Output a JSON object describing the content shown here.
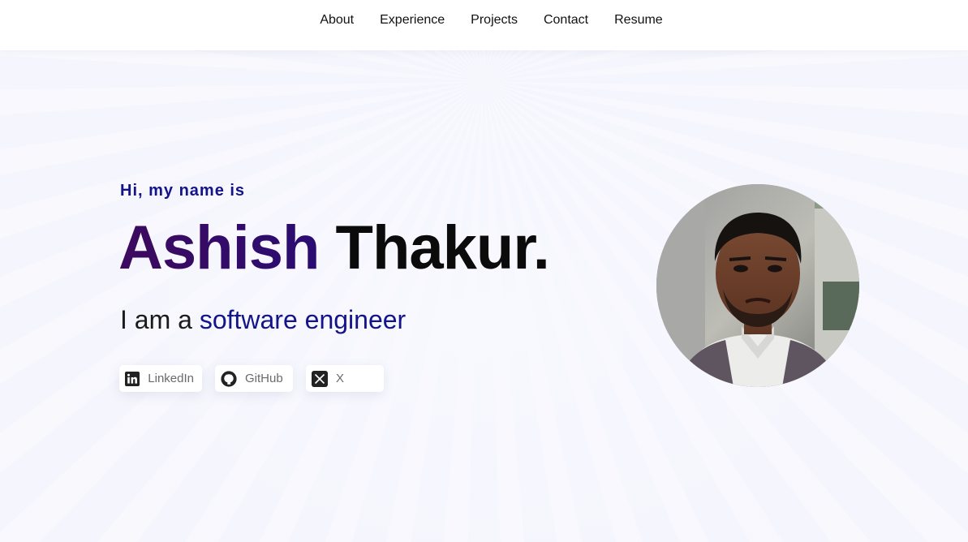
{
  "nav": {
    "items": [
      {
        "label": "About"
      },
      {
        "label": "Experience"
      },
      {
        "label": "Projects"
      },
      {
        "label": "Contact"
      },
      {
        "label": "Resume"
      }
    ]
  },
  "hero": {
    "greeting": "Hi, my name is",
    "first_name": "Ashish",
    "last_name": "Thakur.",
    "tagline_prefix": "I am a",
    "tagline_role": "software engineer"
  },
  "socials": [
    {
      "label": "LinkedIn",
      "icon": "linkedin-icon"
    },
    {
      "label": "GitHub",
      "icon": "github-icon"
    },
    {
      "label": "X",
      "icon": "x-icon"
    }
  ],
  "colors": {
    "accent": "#14148a",
    "name_gradient_start": "#3d0a5e",
    "name_gradient_end": "#2a0c72",
    "background": "#f5f5fd"
  }
}
